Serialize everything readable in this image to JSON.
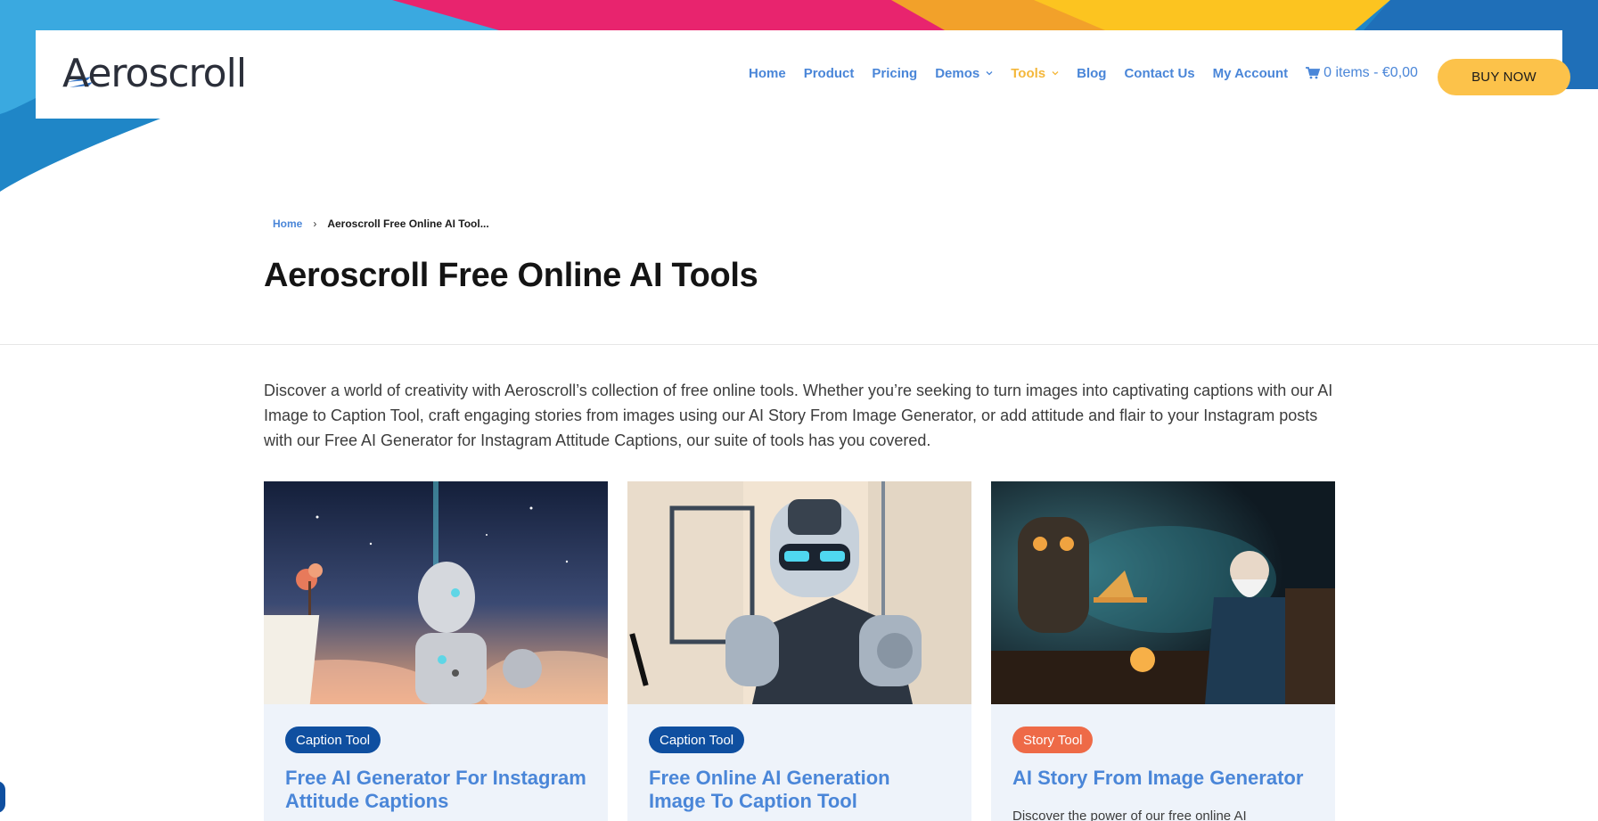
{
  "logo": {
    "text": "Aeroscroll"
  },
  "nav": {
    "items": [
      {
        "label": "Home"
      },
      {
        "label": "Product"
      },
      {
        "label": "Pricing"
      },
      {
        "label": "Demos"
      },
      {
        "label": "Tools"
      },
      {
        "label": "Blog"
      },
      {
        "label": "Contact Us"
      },
      {
        "label": "My Account"
      }
    ],
    "cart_label": "0 items - €0,00",
    "buy_label": "BUY NOW"
  },
  "breadcrumb": {
    "home": "Home",
    "current": "Aeroscroll Free Online AI Tool..."
  },
  "page": {
    "title": "Aeroscroll Free Online AI Tools",
    "intro": "Discover a world of creativity with Aeroscroll’s collection of free online tools. Whether you’re seeking to turn images into captivating captions with our AI Image to Caption Tool, craft engaging stories from images using our AI Story From Image Generator, or add attitude and flair to your Instagram posts with our Free AI Generator for Instagram Attitude Captions, our suite of tools has you covered."
  },
  "cards": [
    {
      "badge": "Caption Tool",
      "title": "Free AI Generator For Instagram Attitude Captions",
      "desc": ""
    },
    {
      "badge": "Caption Tool",
      "title": "Free Online AI Generation Image To Caption Tool",
      "desc": ""
    },
    {
      "badge": "Story Tool",
      "title": "AI Story From Image Generator",
      "desc": "Discover the power of our free online AI"
    }
  ],
  "colors": {
    "accent": "#4a86d8",
    "active_nav": "#f4b73a",
    "buy_button": "#fcc24a",
    "badge_caption": "#0f4fa0",
    "badge_story": "#ee6a47",
    "card_bg": "#eef3fa"
  },
  "icons": {
    "cart": "cart-icon",
    "caret": "chevron-down-icon",
    "breadcrumb_sep": "chevron-right-icon"
  }
}
